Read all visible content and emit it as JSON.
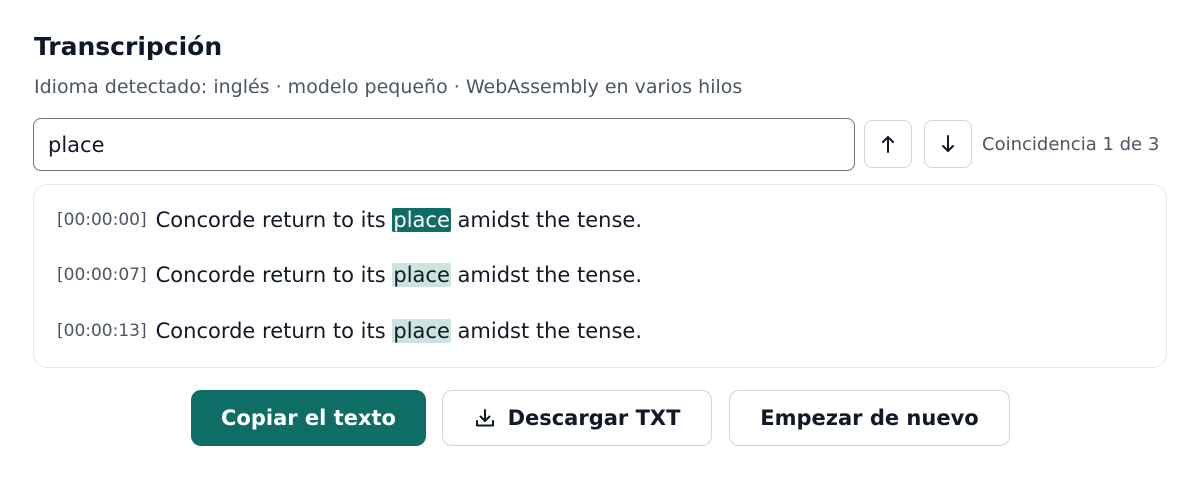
{
  "header": {
    "title": "Transcripción",
    "subtitle": "Idioma detectado: inglés · modelo pequeño · WebAssembly en varios hilos"
  },
  "search": {
    "value": "place",
    "placeholder": "",
    "prev_icon": "arrow-up-icon",
    "next_icon": "arrow-down-icon",
    "match_status": "Coincidencia 1 de 3"
  },
  "segments": [
    {
      "timestamp": "[00:00:00]",
      "before": "Concorde return to its ",
      "match": "place",
      "after": " amidst the tense.",
      "active": true
    },
    {
      "timestamp": "[00:00:07]",
      "before": "Concorde return to its ",
      "match": "place",
      "after": " amidst the tense.",
      "active": false
    },
    {
      "timestamp": "[00:00:13]",
      "before": "Concorde return to its ",
      "match": "place",
      "after": " amidst the tense.",
      "active": false
    }
  ],
  "actions": {
    "copy_label": "Copiar el texto",
    "download_label": "Descargar TXT",
    "download_icon": "download-icon",
    "restart_label": "Empezar de nuevo"
  },
  "colors": {
    "accent": "#0e6e65",
    "match_highlight": "#cde3df"
  }
}
